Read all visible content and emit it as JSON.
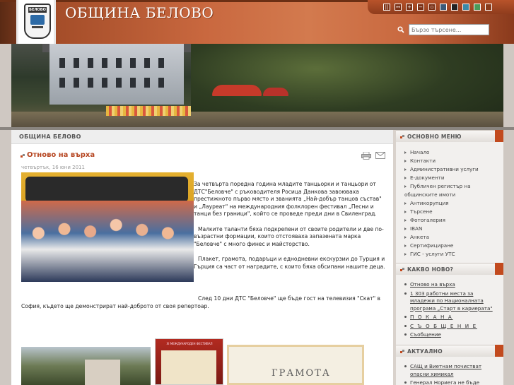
{
  "header": {
    "site_title": "ОБЩИНА БЕЛОВО",
    "logo_text": "БЕЛОВО",
    "search": {
      "placeholder": "Бързо търсене..."
    },
    "swatches": [
      "#3a5a7a",
      "#222222",
      "#3a8aa8",
      "#4a9a5a",
      "#8a3c1c"
    ]
  },
  "breadcrumb": "ОБЩИНА БЕЛОВО",
  "article": {
    "title": "Отново на върха",
    "date": "четвъртък, 16 юни 2011",
    "paragraphs": [
      "За четвърта поредна година младите танцьорки и танцьори от ДТС\"Беловче\" с ръководителя Росица Данкова завоюваха престижното първо място и званията „Най-добър танцов състав\" и „Лауреат\" на международния фолклорен фестивал „Песни и танци без граници\", който се проведе преди дни в Свиленград.",
      "Малките таланти бяха подкрепени от своите родители и две по-възрастни формации, които отстояваха запазената марка \"Беловче\" с много финес и майсторство.",
      "Плакет, грамота, подаръци и еднодневни екскурзии до Турция и Гърция са част от наградите, с които бяха обсипани нашите деца."
    ],
    "last_paragraph": "След 10 дни ДТС \"Беловче\" ще бъде гост на телевизия \"Скат\" в София, където ще демонстрират най-доброто от своя репертоар.",
    "thumb2_caption": "XI МЕЖДУНАРОДЕН ФЕСТИВАЛ",
    "thumb3_caption": "ГРАМОТА"
  },
  "sidebar": {
    "main_menu_title": "ОСНОВНО МЕНЮ",
    "main_menu": [
      "Начало",
      "Контакти",
      "Административни услуги",
      "Е-документи",
      "Публичен регистър на",
      "общинските имоти",
      "Антикорупция",
      "Търсене",
      "Фотогалерия",
      "IBAN",
      "Анкета",
      "Сертифициране",
      "ГИС - услуги УТС"
    ],
    "whats_new_title": "КАКВО НОВО?",
    "whats_new": [
      "Отново на върха",
      "1 303 работни места за младежи по Националната програма „Старт в кариерата\"",
      "П О К А Н А",
      "С Ъ О Б Щ Е Н И Е",
      "Съобщение"
    ],
    "current_title": "АКТУАЛНО",
    "current": [
      "САЩ и Виетнам почистват опасни химикал",
      "Генерал Нориега не бъде"
    ]
  }
}
